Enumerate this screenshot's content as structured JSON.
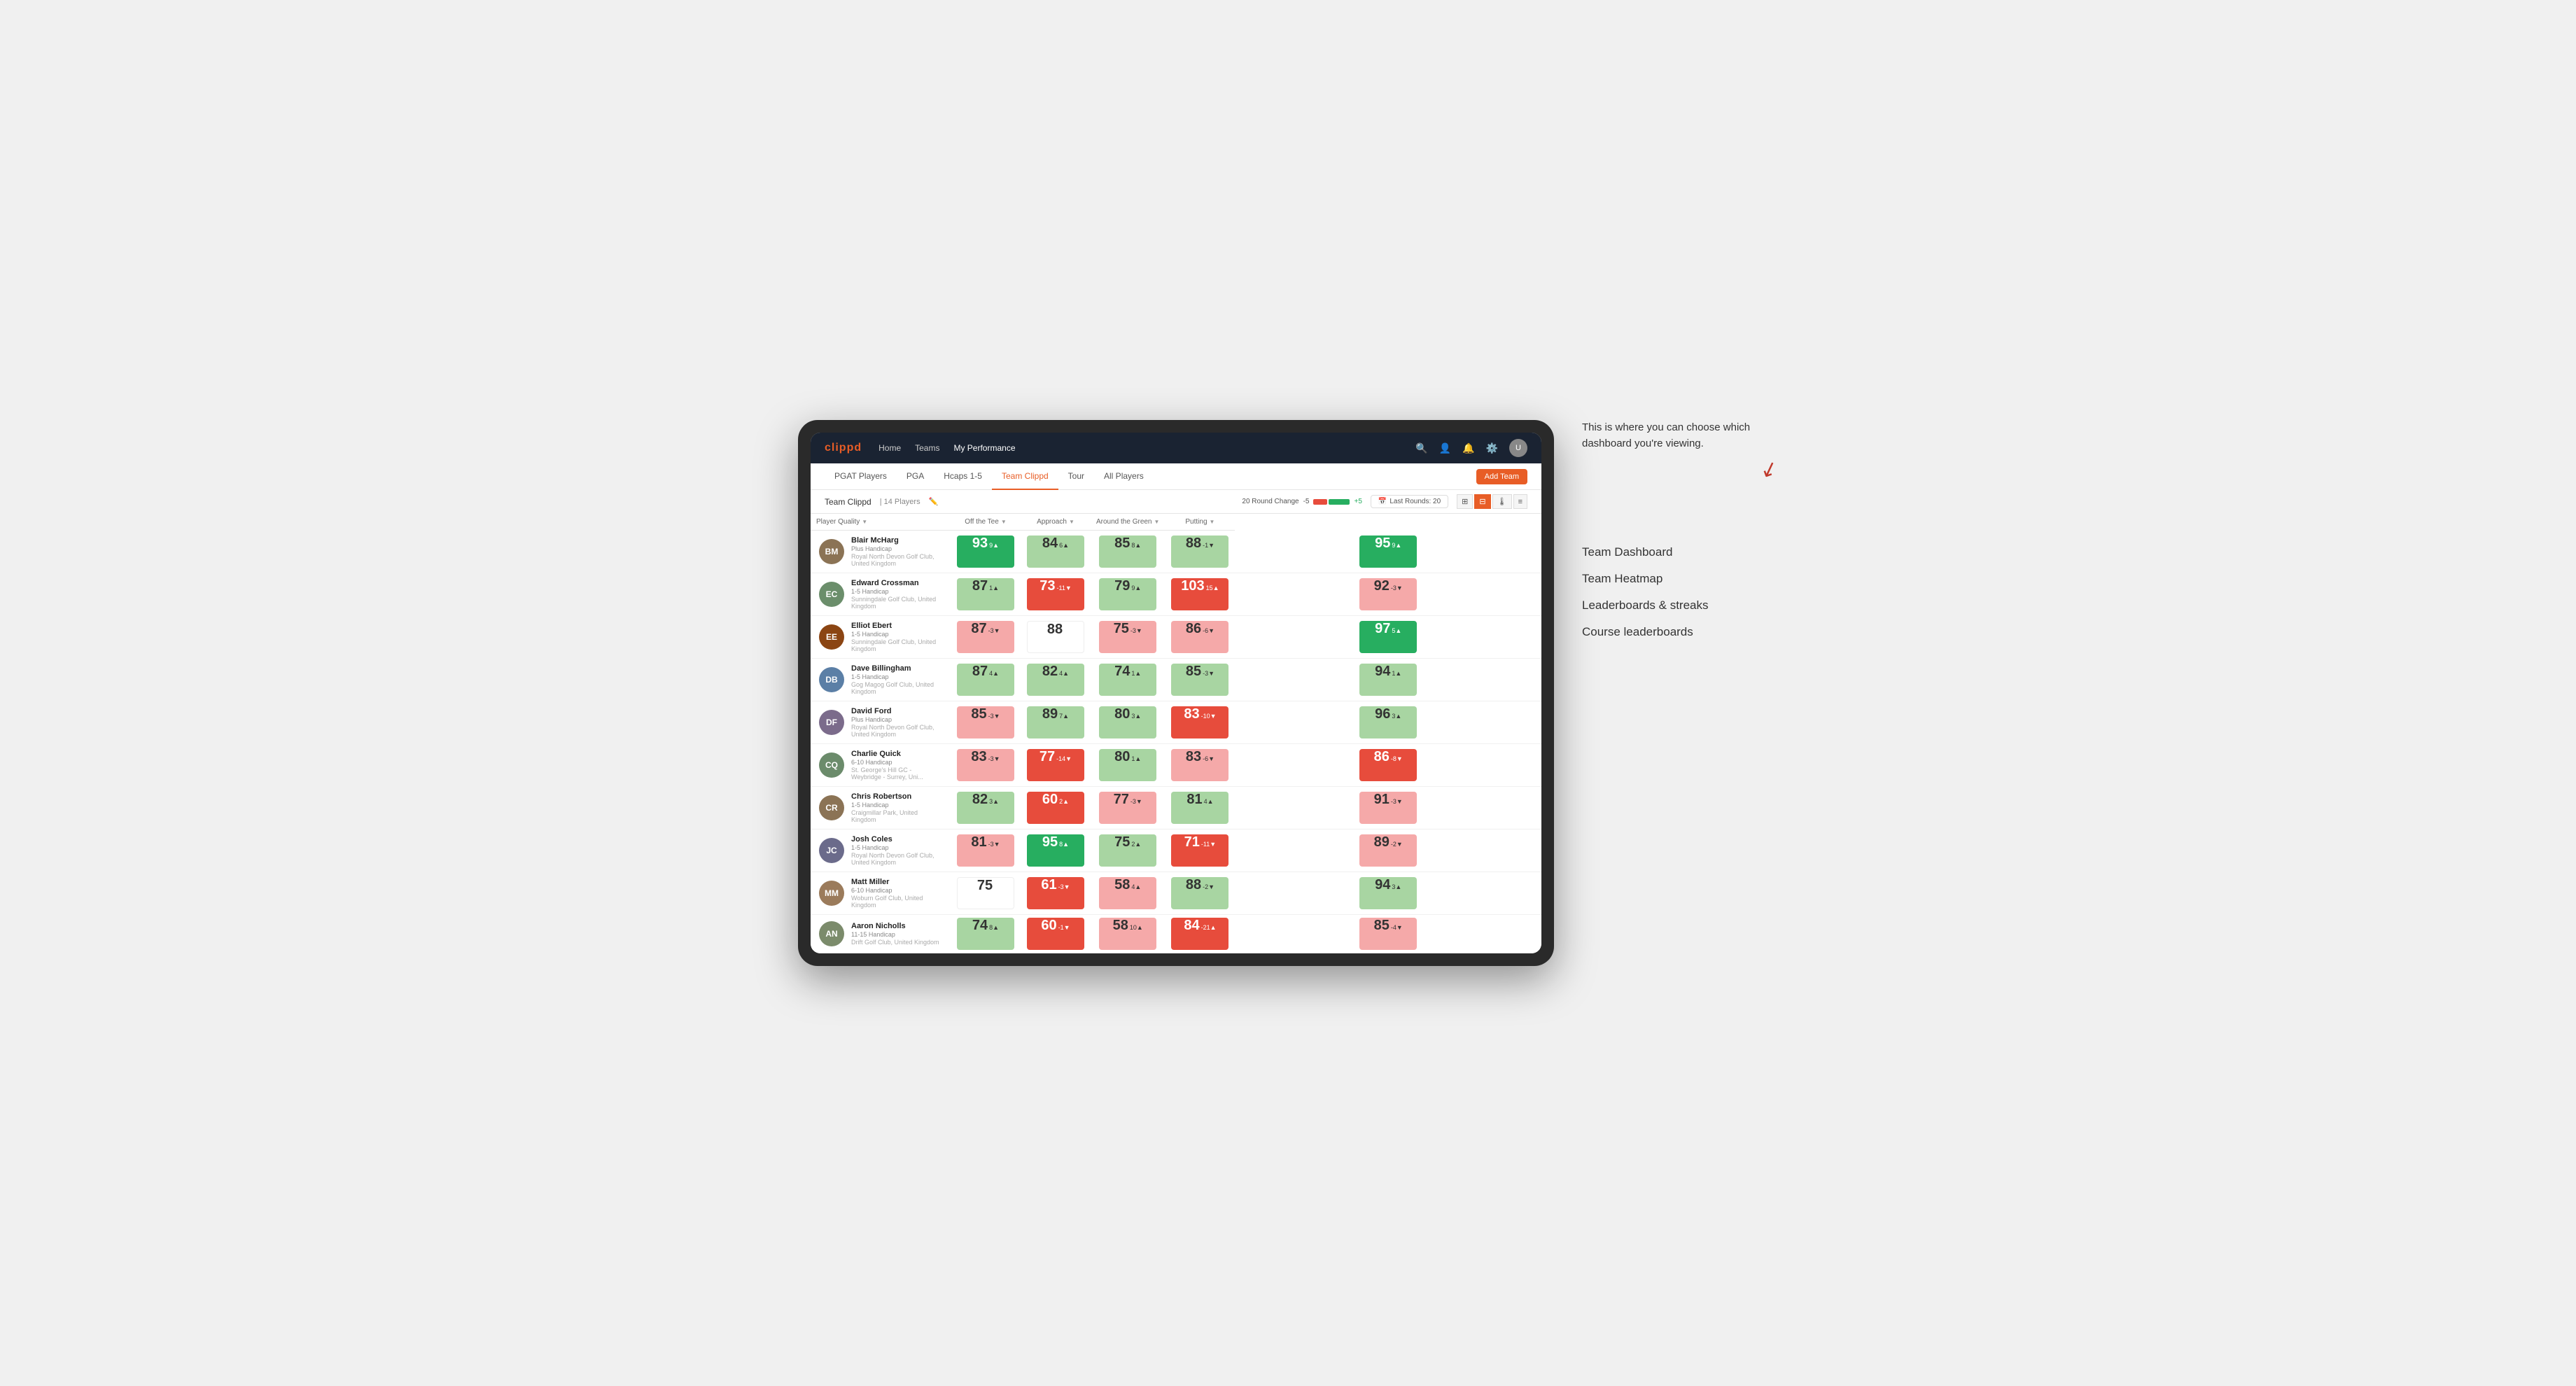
{
  "app": {
    "logo": "clippd",
    "nav_links": [
      {
        "label": "Home",
        "active": false
      },
      {
        "label": "Teams",
        "active": false
      },
      {
        "label": "My Performance",
        "active": true
      }
    ],
    "sub_nav_links": [
      {
        "label": "PGAT Players",
        "active": false
      },
      {
        "label": "PGA",
        "active": false
      },
      {
        "label": "Hcaps 1-5",
        "active": false
      },
      {
        "label": "Team Clippd",
        "active": true
      },
      {
        "label": "Tour",
        "active": false
      },
      {
        "label": "All Players",
        "active": false
      }
    ],
    "add_team_label": "Add Team"
  },
  "team_bar": {
    "name": "Team Clippd",
    "separator": "|",
    "count": "14 Players",
    "round_change_label": "20 Round Change",
    "round_change_low": "-5",
    "round_change_high": "+5",
    "last_rounds_label": "Last Rounds:",
    "last_rounds_value": "20"
  },
  "table": {
    "columns": [
      {
        "label": "Player Quality",
        "sortable": true
      },
      {
        "label": "Off the Tee",
        "sortable": true
      },
      {
        "label": "Approach",
        "sortable": true
      },
      {
        "label": "Around the Green",
        "sortable": true
      },
      {
        "label": "Putting",
        "sortable": true
      }
    ],
    "rows": [
      {
        "name": "Blair McHarg",
        "handicap": "Plus Handicap",
        "club": "Royal North Devon Golf Club, United Kingdom",
        "avatar_color": "#8B7355",
        "initials": "BM",
        "scores": [
          {
            "value": "93",
            "delta": "9▲",
            "color": "green-dark"
          },
          {
            "value": "84",
            "delta": "6▲",
            "color": "green-light"
          },
          {
            "value": "85",
            "delta": "8▲",
            "color": "green-light"
          },
          {
            "value": "88",
            "delta": "-1▼",
            "color": "green-light"
          },
          {
            "value": "95",
            "delta": "9▲",
            "color": "green-dark"
          }
        ]
      },
      {
        "name": "Edward Crossman",
        "handicap": "1-5 Handicap",
        "club": "Sunningdale Golf Club, United Kingdom",
        "avatar_color": "#6B8E6B",
        "initials": "EC",
        "scores": [
          {
            "value": "87",
            "delta": "1▲",
            "color": "green-light"
          },
          {
            "value": "73",
            "delta": "-11▼",
            "color": "red-dark"
          },
          {
            "value": "79",
            "delta": "9▲",
            "color": "green-light"
          },
          {
            "value": "103",
            "delta": "15▲",
            "color": "red-dark"
          },
          {
            "value": "92",
            "delta": "-3▼",
            "color": "red-light"
          }
        ]
      },
      {
        "name": "Elliot Ebert",
        "handicap": "1-5 Handicap",
        "club": "Sunningdale Golf Club, United Kingdom",
        "avatar_color": "#8B4513",
        "initials": "EE",
        "scores": [
          {
            "value": "87",
            "delta": "-3▼",
            "color": "red-light"
          },
          {
            "value": "88",
            "delta": "",
            "color": "neutral"
          },
          {
            "value": "75",
            "delta": "-3▼",
            "color": "red-light"
          },
          {
            "value": "86",
            "delta": "-6▼",
            "color": "red-light"
          },
          {
            "value": "97",
            "delta": "5▲",
            "color": "green-dark"
          }
        ]
      },
      {
        "name": "Dave Billingham",
        "handicap": "1-5 Handicap",
        "club": "Gog Magog Golf Club, United Kingdom",
        "avatar_color": "#5B7FA6",
        "initials": "DB",
        "scores": [
          {
            "value": "87",
            "delta": "4▲",
            "color": "green-light"
          },
          {
            "value": "82",
            "delta": "4▲",
            "color": "green-light"
          },
          {
            "value": "74",
            "delta": "1▲",
            "color": "green-light"
          },
          {
            "value": "85",
            "delta": "-3▼",
            "color": "green-light"
          },
          {
            "value": "94",
            "delta": "1▲",
            "color": "green-light"
          }
        ]
      },
      {
        "name": "David Ford",
        "handicap": "Plus Handicap",
        "club": "Royal North Devon Golf Club, United Kingdom",
        "avatar_color": "#7B6B8B",
        "initials": "DF",
        "scores": [
          {
            "value": "85",
            "delta": "-3▼",
            "color": "red-light"
          },
          {
            "value": "89",
            "delta": "7▲",
            "color": "green-light"
          },
          {
            "value": "80",
            "delta": "3▲",
            "color": "green-light"
          },
          {
            "value": "83",
            "delta": "-10▼",
            "color": "red-dark"
          },
          {
            "value": "96",
            "delta": "3▲",
            "color": "green-light"
          }
        ]
      },
      {
        "name": "Charlie Quick",
        "handicap": "6-10 Handicap",
        "club": "St. George's Hill GC - Weybridge - Surrey, Uni...",
        "avatar_color": "#6B8B6B",
        "initials": "CQ",
        "scores": [
          {
            "value": "83",
            "delta": "-3▼",
            "color": "red-light"
          },
          {
            "value": "77",
            "delta": "-14▼",
            "color": "red-dark"
          },
          {
            "value": "80",
            "delta": "1▲",
            "color": "green-light"
          },
          {
            "value": "83",
            "delta": "-6▼",
            "color": "red-light"
          },
          {
            "value": "86",
            "delta": "-8▼",
            "color": "red-dark"
          }
        ]
      },
      {
        "name": "Chris Robertson",
        "handicap": "1-5 Handicap",
        "club": "Craigmillar Park, United Kingdom",
        "avatar_color": "#8B7355",
        "initials": "CR",
        "scores": [
          {
            "value": "82",
            "delta": "3▲",
            "color": "green-light"
          },
          {
            "value": "60",
            "delta": "2▲",
            "color": "red-dark"
          },
          {
            "value": "77",
            "delta": "-3▼",
            "color": "red-light"
          },
          {
            "value": "81",
            "delta": "4▲",
            "color": "green-light"
          },
          {
            "value": "91",
            "delta": "-3▼",
            "color": "red-light"
          }
        ]
      },
      {
        "name": "Josh Coles",
        "handicap": "1-5 Handicap",
        "club": "Royal North Devon Golf Club, United Kingdom",
        "avatar_color": "#6B6B8B",
        "initials": "JC",
        "scores": [
          {
            "value": "81",
            "delta": "-3▼",
            "color": "red-light"
          },
          {
            "value": "95",
            "delta": "8▲",
            "color": "green-dark"
          },
          {
            "value": "75",
            "delta": "2▲",
            "color": "green-light"
          },
          {
            "value": "71",
            "delta": "-11▼",
            "color": "red-dark"
          },
          {
            "value": "89",
            "delta": "-2▼",
            "color": "red-light"
          }
        ]
      },
      {
        "name": "Matt Miller",
        "handicap": "6-10 Handicap",
        "club": "Woburn Golf Club, United Kingdom",
        "avatar_color": "#9B7B5B",
        "initials": "MM",
        "scores": [
          {
            "value": "75",
            "delta": "",
            "color": "neutral"
          },
          {
            "value": "61",
            "delta": "-3▼",
            "color": "red-dark"
          },
          {
            "value": "58",
            "delta": "4▲",
            "color": "red-light"
          },
          {
            "value": "88",
            "delta": "-2▼",
            "color": "green-light"
          },
          {
            "value": "94",
            "delta": "3▲",
            "color": "green-light"
          }
        ]
      },
      {
        "name": "Aaron Nicholls",
        "handicap": "11-15 Handicap",
        "club": "Drift Golf Club, United Kingdom",
        "avatar_color": "#7B8B6B",
        "initials": "AN",
        "scores": [
          {
            "value": "74",
            "delta": "8▲",
            "color": "green-light"
          },
          {
            "value": "60",
            "delta": "-1▼",
            "color": "red-dark"
          },
          {
            "value": "58",
            "delta": "10▲",
            "color": "red-light"
          },
          {
            "value": "84",
            "delta": "-21▲",
            "color": "red-dark"
          },
          {
            "value": "85",
            "delta": "-4▼",
            "color": "red-light"
          }
        ]
      }
    ]
  },
  "annotation": {
    "callout_text": "This is where you can choose which dashboard you're viewing.",
    "items": [
      "Team Dashboard",
      "Team Heatmap",
      "Leaderboards & streaks",
      "Course leaderboards"
    ]
  }
}
